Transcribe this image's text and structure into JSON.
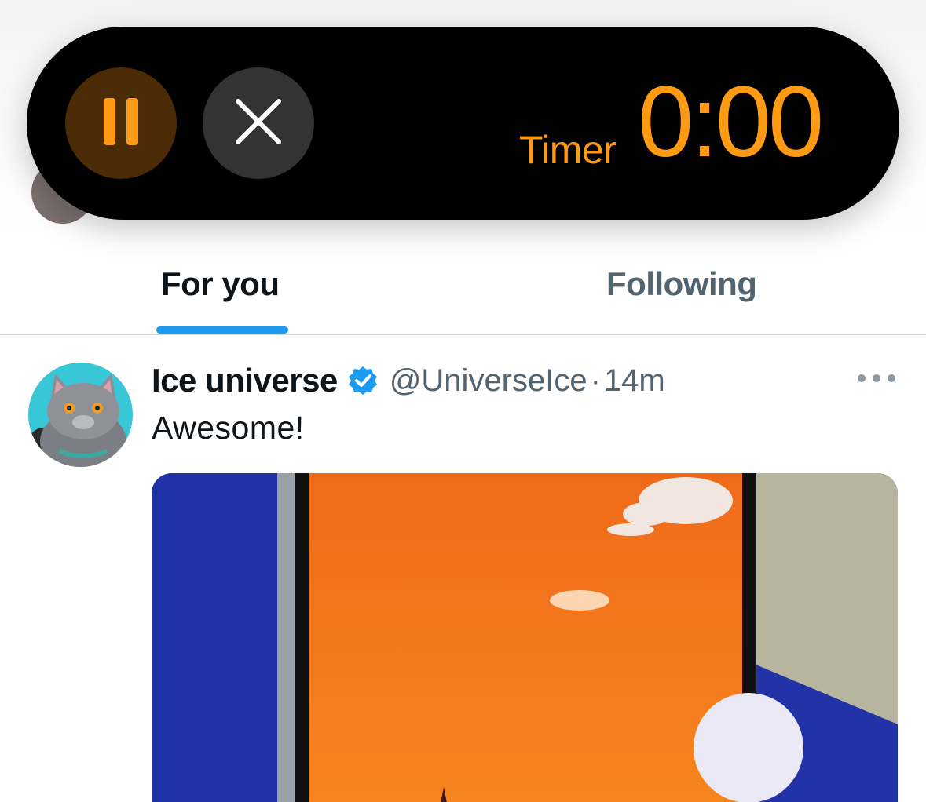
{
  "live_activity": {
    "timer_label": "Timer",
    "timer_value": "0:00",
    "pause_icon": "pause-icon",
    "close_icon": "close-icon",
    "accent_color": "#ff9a14"
  },
  "tabs": [
    {
      "label": "For you",
      "selected": true
    },
    {
      "label": "Following",
      "selected": false
    }
  ],
  "tweet": {
    "display_name": "Ice universe",
    "verified": true,
    "handle": "@UniverseIce",
    "separator": "·",
    "time": "14m",
    "text": "Awesome!",
    "more_icon": "more-icon",
    "media_icon": "photo"
  },
  "colors": {
    "link_blue": "#1d9bf0",
    "text_primary": "#0f1419",
    "text_secondary": "#536471"
  }
}
